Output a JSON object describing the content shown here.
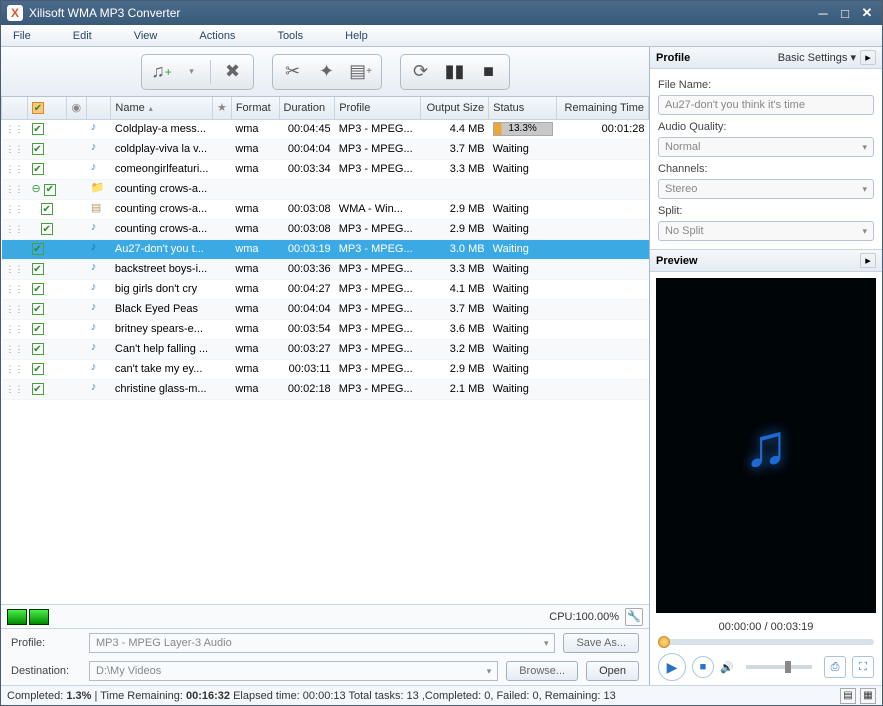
{
  "title": "Xilisoft WMA MP3 Converter",
  "menu": [
    "File",
    "Edit",
    "View",
    "Actions",
    "Tools",
    "Help"
  ],
  "columns": {
    "chk": "",
    "disc": "",
    "name": "Name",
    "star": "",
    "format": "Format",
    "duration": "Duration",
    "profile": "Profile",
    "output": "Output Size",
    "status": "Status",
    "remaining": "Remaining Time"
  },
  "rows": [
    {
      "indent": 0,
      "icon": "note",
      "name": "Coldplay-a mess...",
      "format": "wma",
      "duration": "00:04:45",
      "profile": "MP3 - MPEG...",
      "output": "4.4 MB",
      "status": "13.3%",
      "progress": true,
      "remaining": "00:01:28"
    },
    {
      "indent": 0,
      "icon": "note",
      "name": "coldplay-viva la v...",
      "format": "wma",
      "duration": "00:04:04",
      "profile": "MP3 - MPEG...",
      "output": "3.7 MB",
      "status": "Waiting",
      "remaining": ""
    },
    {
      "indent": 0,
      "icon": "note",
      "name": "comeongirlfeaturi...",
      "format": "wma",
      "duration": "00:03:34",
      "profile": "MP3 - MPEG...",
      "output": "3.3 MB",
      "status": "Waiting",
      "remaining": ""
    },
    {
      "indent": 0,
      "icon": "folder",
      "collapse": true,
      "name": "counting crows-a...",
      "format": "",
      "duration": "",
      "profile": "",
      "output": "",
      "status": "",
      "remaining": ""
    },
    {
      "indent": 1,
      "icon": "page",
      "name": "counting crows-a...",
      "format": "wma",
      "duration": "00:03:08",
      "profile": "WMA - Win...",
      "output": "2.9 MB",
      "status": "Waiting",
      "remaining": ""
    },
    {
      "indent": 1,
      "icon": "note",
      "name": "counting crows-a...",
      "format": "wma",
      "duration": "00:03:08",
      "profile": "MP3 - MPEG...",
      "output": "2.9 MB",
      "status": "Waiting",
      "remaining": ""
    },
    {
      "indent": 0,
      "icon": "noteb",
      "name": "Au27-don't you t...",
      "format": "wma",
      "duration": "00:03:19",
      "profile": "MP3 - MPEG...",
      "output": "3.0 MB",
      "status": "Waiting",
      "remaining": "",
      "sel": true
    },
    {
      "indent": 0,
      "icon": "note",
      "name": "backstreet boys-i...",
      "format": "wma",
      "duration": "00:03:36",
      "profile": "MP3 - MPEG...",
      "output": "3.3 MB",
      "status": "Waiting",
      "remaining": ""
    },
    {
      "indent": 0,
      "icon": "note",
      "name": "big girls don't cry",
      "format": "wma",
      "duration": "00:04:27",
      "profile": "MP3 - MPEG...",
      "output": "4.1 MB",
      "status": "Waiting",
      "remaining": ""
    },
    {
      "indent": 0,
      "icon": "note",
      "name": "Black Eyed Peas",
      "format": "wma",
      "duration": "00:04:04",
      "profile": "MP3 - MPEG...",
      "output": "3.7 MB",
      "status": "Waiting",
      "remaining": ""
    },
    {
      "indent": 0,
      "icon": "note",
      "name": "britney spears-e...",
      "format": "wma",
      "duration": "00:03:54",
      "profile": "MP3 - MPEG...",
      "output": "3.6 MB",
      "status": "Waiting",
      "remaining": ""
    },
    {
      "indent": 0,
      "icon": "note",
      "name": "Can't help falling ...",
      "format": "wma",
      "duration": "00:03:27",
      "profile": "MP3 - MPEG...",
      "output": "3.2 MB",
      "status": "Waiting",
      "remaining": ""
    },
    {
      "indent": 0,
      "icon": "note",
      "name": "can't take my ey...",
      "format": "wma",
      "duration": "00:03:11",
      "profile": "MP3 - MPEG...",
      "output": "2.9 MB",
      "status": "Waiting",
      "remaining": ""
    },
    {
      "indent": 0,
      "icon": "note",
      "name": "christine glass-m...",
      "format": "wma",
      "duration": "00:02:18",
      "profile": "MP3 - MPEG...",
      "output": "2.1 MB",
      "status": "Waiting",
      "remaining": ""
    }
  ],
  "profilePanel": {
    "title": "Profile",
    "opt": "Basic Settings ▾",
    "labels": {
      "file": "File Name:",
      "quality": "Audio Quality:",
      "channels": "Channels:",
      "split": "Split:"
    },
    "values": {
      "file": "Au27-don't you think it's time",
      "quality": "Normal",
      "channels": "Stereo",
      "split": "No Split"
    }
  },
  "preview": {
    "title": "Preview",
    "time": "00:00:00 / 00:03:19"
  },
  "cpu": "CPU:100.00%",
  "dest": {
    "profileLbl": "Profile:",
    "profileVal": "MP3 - MPEG Layer-3 Audio",
    "saveAs": "Save As...",
    "destLbl": "Destination:",
    "destVal": "D:\\My Videos",
    "browse": "Browse...",
    "open": "Open"
  },
  "status": {
    "completedLbl": "Completed:",
    "completedVal": "1.3%",
    "timeRemLbl": "Time Remaining:",
    "timeRemVal": "00:16:32",
    "elapsed": "Elapsed time: 00:00:13",
    "totals": "Total tasks: 13 ,Completed: 0, Failed: 0, Remaining: 13"
  }
}
